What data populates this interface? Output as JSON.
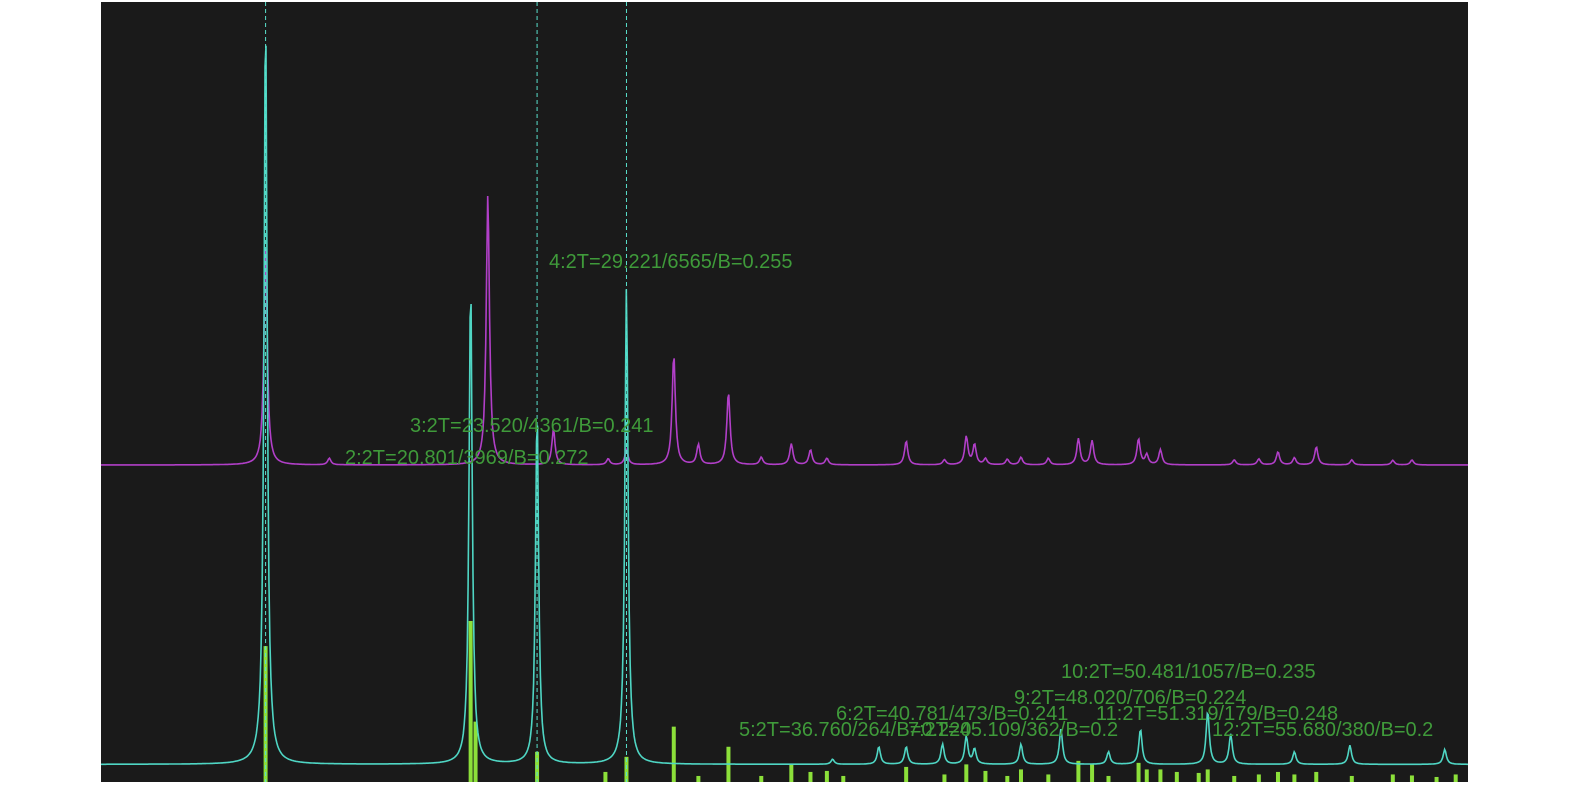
{
  "chart_data": {
    "type": "line",
    "title": "",
    "xlabel": "",
    "ylabel": "",
    "xlim": [
      10,
      60
    ],
    "ylim": [
      0,
      15500
    ],
    "grid": false,
    "colors": {
      "background": "#1a1a1a",
      "plot_frame": "#ffffff",
      "reference_pattern": "#b13fc8",
      "measured_pattern": "#4fd6c4",
      "peak_bars": "#8ce03a",
      "peak_marker_line": "#59e0cc",
      "peak_label": "#3f9a3a"
    },
    "series": [
      {
        "role": "reference",
        "baseline": 6300,
        "peaks": [
          {
            "x": 16.02,
            "y": 4500
          },
          {
            "x": 18.35,
            "y": 130
          },
          {
            "x": 24.15,
            "y": 5400
          },
          {
            "x": 26.55,
            "y": 700
          },
          {
            "x": 28.55,
            "y": 120
          },
          {
            "x": 29.22,
            "y": 300
          },
          {
            "x": 30.95,
            "y": 2200
          },
          {
            "x": 31.85,
            "y": 400
          },
          {
            "x": 32.95,
            "y": 1450
          },
          {
            "x": 34.15,
            "y": 150
          },
          {
            "x": 35.25,
            "y": 420
          },
          {
            "x": 35.95,
            "y": 300
          },
          {
            "x": 36.55,
            "y": 130
          },
          {
            "x": 39.45,
            "y": 480
          },
          {
            "x": 40.85,
            "y": 100
          },
          {
            "x": 41.65,
            "y": 560
          },
          {
            "x": 41.95,
            "y": 400
          },
          {
            "x": 42.35,
            "y": 120
          },
          {
            "x": 43.15,
            "y": 110
          },
          {
            "x": 43.65,
            "y": 150
          },
          {
            "x": 44.65,
            "y": 130
          },
          {
            "x": 45.75,
            "y": 520
          },
          {
            "x": 46.25,
            "y": 480
          },
          {
            "x": 47.95,
            "y": 520
          },
          {
            "x": 48.25,
            "y": 200
          },
          {
            "x": 48.75,
            "y": 300
          },
          {
            "x": 51.45,
            "y": 100
          },
          {
            "x": 52.35,
            "y": 120
          },
          {
            "x": 53.05,
            "y": 260
          },
          {
            "x": 53.65,
            "y": 140
          },
          {
            "x": 54.45,
            "y": 360
          },
          {
            "x": 55.75,
            "y": 100
          },
          {
            "x": 57.25,
            "y": 90
          },
          {
            "x": 57.95,
            "y": 100
          }
        ]
      },
      {
        "role": "measured",
        "baseline": 350,
        "peaks": [
          {
            "x": 16.02,
            "y": 15000
          },
          {
            "x": 23.52,
            "y": 9600
          },
          {
            "x": 25.95,
            "y": 7000
          },
          {
            "x": 29.22,
            "y": 9500
          },
          {
            "x": 36.76,
            "y": 100
          },
          {
            "x": 38.45,
            "y": 350
          },
          {
            "x": 39.45,
            "y": 350
          },
          {
            "x": 40.78,
            "y": 400
          },
          {
            "x": 45.11,
            "y": 700
          },
          {
            "x": 41.65,
            "y": 550
          },
          {
            "x": 41.95,
            "y": 300
          },
          {
            "x": 43.65,
            "y": 400
          },
          {
            "x": 46.85,
            "y": 250
          },
          {
            "x": 48.02,
            "y": 700
          },
          {
            "x": 50.48,
            "y": 1057
          },
          {
            "x": 51.32,
            "y": 600
          },
          {
            "x": 53.65,
            "y": 250
          },
          {
            "x": 55.68,
            "y": 380
          },
          {
            "x": 59.15,
            "y": 300
          }
        ]
      }
    ],
    "peak_bars": [
      {
        "x": 16.02,
        "y": 2700
      },
      {
        "x": 23.52,
        "y": 3200
      },
      {
        "x": 23.7,
        "y": 1200
      },
      {
        "x": 25.95,
        "y": 600
      },
      {
        "x": 29.22,
        "y": 500
      },
      {
        "x": 28.45,
        "y": 200
      },
      {
        "x": 30.95,
        "y": 1100
      },
      {
        "x": 31.85,
        "y": 120
      },
      {
        "x": 32.95,
        "y": 700
      },
      {
        "x": 34.15,
        "y": 120
      },
      {
        "x": 35.25,
        "y": 350
      },
      {
        "x": 35.95,
        "y": 200
      },
      {
        "x": 36.55,
        "y": 220
      },
      {
        "x": 37.15,
        "y": 120
      },
      {
        "x": 39.45,
        "y": 300
      },
      {
        "x": 40.85,
        "y": 150
      },
      {
        "x": 41.65,
        "y": 350
      },
      {
        "x": 42.35,
        "y": 220
      },
      {
        "x": 43.15,
        "y": 120
      },
      {
        "x": 43.65,
        "y": 250
      },
      {
        "x": 44.65,
        "y": 150
      },
      {
        "x": 45.75,
        "y": 420
      },
      {
        "x": 46.25,
        "y": 350
      },
      {
        "x": 46.85,
        "y": 120
      },
      {
        "x": 47.95,
        "y": 380
      },
      {
        "x": 48.25,
        "y": 250
      },
      {
        "x": 48.75,
        "y": 250
      },
      {
        "x": 49.35,
        "y": 200
      },
      {
        "x": 50.15,
        "y": 180
      },
      {
        "x": 50.48,
        "y": 250
      },
      {
        "x": 51.45,
        "y": 120
      },
      {
        "x": 52.35,
        "y": 150
      },
      {
        "x": 53.05,
        "y": 200
      },
      {
        "x": 53.65,
        "y": 150
      },
      {
        "x": 54.45,
        "y": 200
      },
      {
        "x": 55.75,
        "y": 120
      },
      {
        "x": 57.25,
        "y": 150
      },
      {
        "x": 57.95,
        "y": 130
      },
      {
        "x": 58.85,
        "y": 100
      },
      {
        "x": 59.55,
        "y": 150
      }
    ],
    "peak_labels": [
      {
        "text": "2:2T=20.801/3969/B=0.272",
        "x": 20.801
      },
      {
        "text": "3:2T=23.520/4361/B=0.241",
        "x": 23.52
      },
      {
        "text": "4:2T=29.221/6565/B=0.255",
        "x": 29.221
      },
      {
        "text": "5:2T=36.760/264/B=0.220",
        "x": 36.76
      },
      {
        "text": "6:2T=40.781/473/B=0.241",
        "x": 40.781
      },
      {
        "text": "7:2T=45.109/362/B=0.2",
        "x": 45.109
      },
      {
        "text": "9:2T=48.020/706/B=0.224",
        "x": 48.02
      },
      {
        "text": "10:2T=50.481/1057/B=0.235",
        "x": 50.481
      },
      {
        "text": "11:2T=51.319/179/B=0.248",
        "x": 51.319
      },
      {
        "text": "12:2T=55.680/380/B=0.2",
        "x": 55.68
      }
    ],
    "peak_marker_lines": [
      16.02,
      25.95,
      29.22
    ]
  }
}
